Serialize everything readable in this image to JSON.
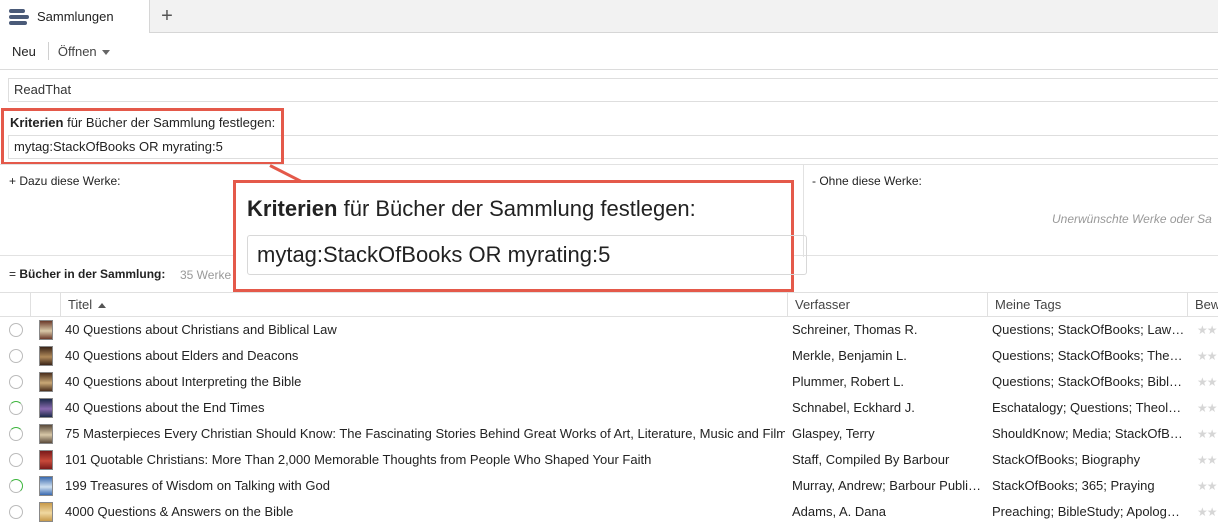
{
  "tab": {
    "label": "Sammlungen",
    "icon": "collections-icon",
    "add_icon": "plus-icon",
    "add_glyph": "+"
  },
  "toolbar": {
    "new_label": "Neu",
    "open_label": "Öffnen"
  },
  "collection": {
    "name": "ReadThat"
  },
  "criteria": {
    "label_bold": "Kriterien",
    "label_rest": " für Bücher der Sammlung festlegen:",
    "value": "mytag:StackOfBooks OR myrating:5"
  },
  "include": {
    "label": "+  Dazu diese Werke:"
  },
  "exclude": {
    "label": "-  Ohne diese Werke:",
    "hint": "Unerwünschte Werke oder Sa"
  },
  "books": {
    "label_prefix": "= ",
    "label_bold": "Bücher in der Sammlung:",
    "count": "35 Werke"
  },
  "callout": {
    "label_bold": "Kriterien",
    "label_rest": " für Bücher der Sammlung festlegen:",
    "value": "mytag:StackOfBooks OR myrating:5"
  },
  "table": {
    "columns": {
      "title": "Titel",
      "author": "Verfasser",
      "tags": "Meine Tags",
      "rating": "Bew"
    },
    "rating_stars": "★★",
    "rows": [
      {
        "title": "40 Questions about Christians and Biblical Law",
        "author": "Schreiner, Thomas R.",
        "tags": "Questions; StackOfBooks; Law…",
        "progress": "none",
        "cover": [
          "#6b3a2a",
          "#d9c9a8"
        ]
      },
      {
        "title": "40 Questions about Elders and Deacons",
        "author": "Merkle, Benjamin L.",
        "tags": "Questions; StackOfBooks; The…",
        "progress": "none",
        "cover": [
          "#3a2418",
          "#b08a5a"
        ]
      },
      {
        "title": "40 Questions about Interpreting the Bible",
        "author": "Plummer, Robert L.",
        "tags": "Questions; StackOfBooks; Bibl…",
        "progress": "none",
        "cover": [
          "#4a2e1c",
          "#c9a876"
        ]
      },
      {
        "title": "40 Questions about the End Times",
        "author": "Schnabel, Eckhard J.",
        "tags": "Eschatalogy; Questions; Theol…",
        "progress": "started",
        "cover": [
          "#1c2a4a",
          "#8a6ab0"
        ]
      },
      {
        "title": "75 Masterpieces Every Christian Should Know: The Fascinating Stories Behind Great Works of Art, Literature, Music and Film",
        "author": "Glaspey, Terry",
        "tags": "ShouldKnow; Media; StackOfB…",
        "progress": "started",
        "cover": [
          "#5a4a3a",
          "#d8c8a8"
        ]
      },
      {
        "title": "101 Quotable Christians: More Than 2,000 Memorable Thoughts from People Who Shaped Your Faith",
        "author": "Staff, Compiled By Barbour",
        "tags": "StackOfBooks; Biography",
        "progress": "none",
        "cover": [
          "#7a1a1a",
          "#c84a3a"
        ]
      },
      {
        "title": "199 Treasures of Wisdom on Talking with God",
        "author": "Murray, Andrew; Barbour Publi…",
        "tags": "StackOfBooks; 365; Praying",
        "progress": "more",
        "cover": [
          "#3a6ab0",
          "#cfe0f0"
        ]
      },
      {
        "title": "4000 Questions & Answers on the Bible",
        "author": "Adams, A. Dana",
        "tags": "Preaching; BibleStudy; Apolog…",
        "progress": "none",
        "cover": [
          "#c89a4a",
          "#f0d8a0"
        ]
      }
    ]
  }
}
